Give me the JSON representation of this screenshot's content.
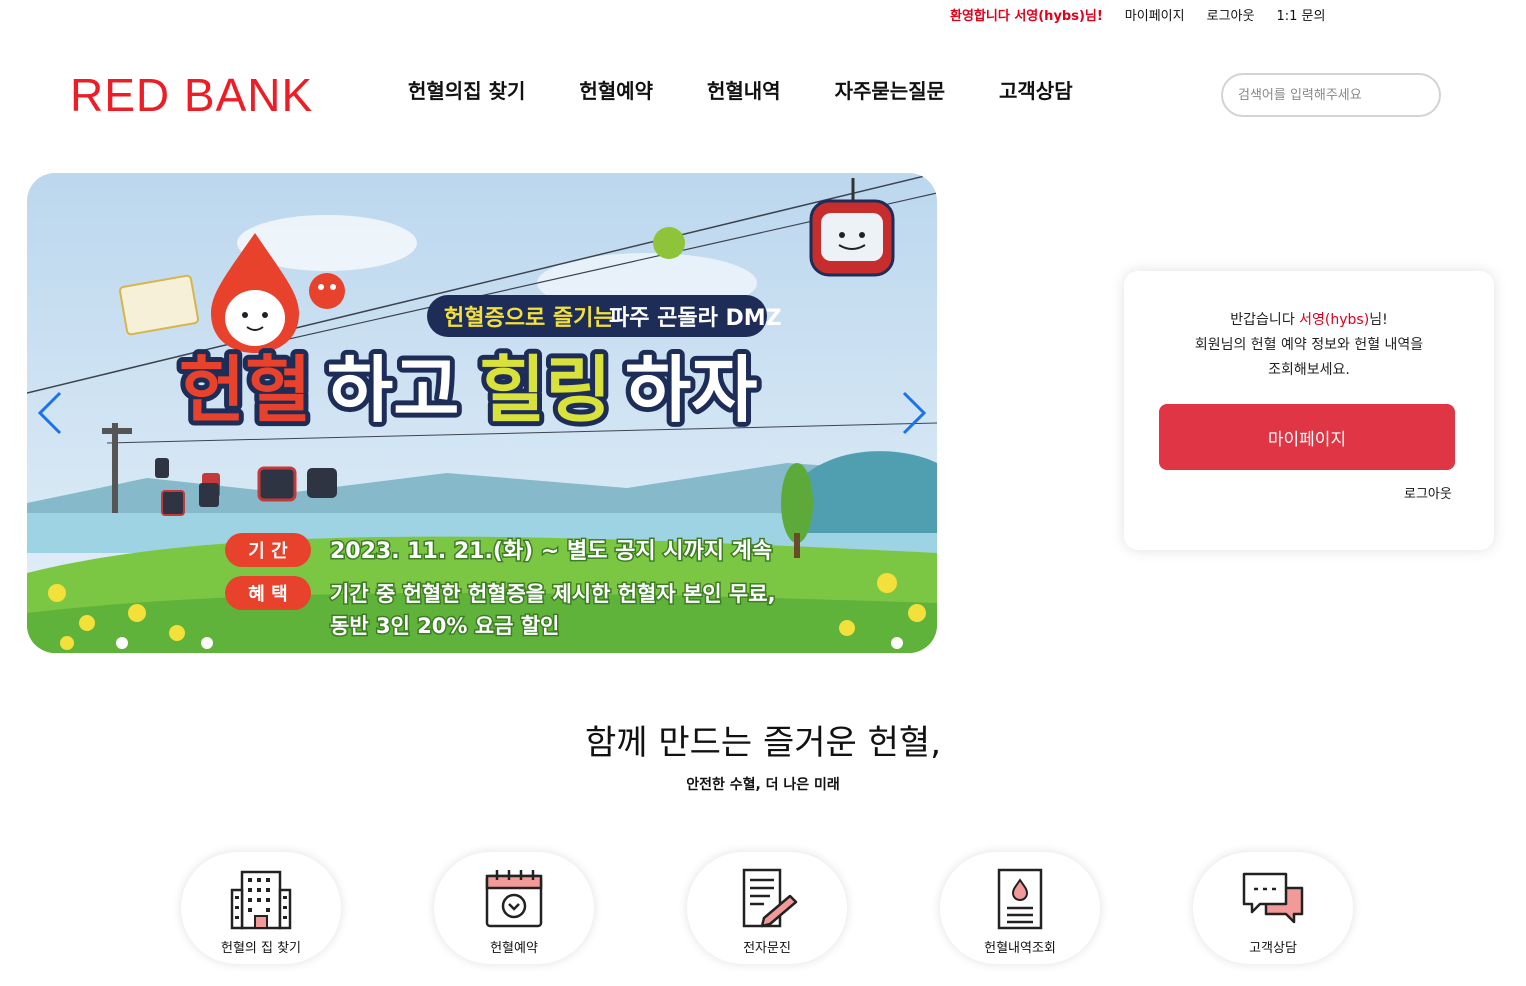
{
  "topbar": {
    "welcome": "환영합니다 서영(hybs)님!",
    "mypage": "마이페이지",
    "logout": "로그아웃",
    "inquiry": "1:1 문의"
  },
  "header": {
    "logo": "RED BANK",
    "nav": [
      "헌혈의집 찾기",
      "헌혈예약",
      "헌혈내역",
      "자주묻는질문",
      "고객상담"
    ],
    "search_placeholder": "검색어를 입력해주세요"
  },
  "banner": {
    "subtitle": "헌혈증으로 즐기는 파주 곤돌라 DMZ",
    "title_a": "헌혈",
    "title_b": "하고 ",
    "title_c": "힐링",
    "title_d": "하자",
    "period_label": "기 간",
    "period_text": "2023. 11. 21.(화) ~ 별도 공지 시까지 계속",
    "benefit_label": "혜 택",
    "benefit_line1": "기간 중 헌혈한 헌혈증을 제시한 헌혈자 본인 무료,",
    "benefit_line2": "동반 3인 20% 요금 할인",
    "colors": {
      "red": "#e8412c",
      "yellow": "#d8e23a",
      "navy": "#1d2d57",
      "grass": "#7bc744"
    }
  },
  "card": {
    "greet_prefix": "반갑습니다 ",
    "name": "서영(hybs)",
    "greet_suffix": "님!",
    "line2": "회원님의 헌혈 예약 정보와 헌혈 내역을",
    "line3": "조회해보세요.",
    "button": "마이페이지",
    "logout": "로그아웃"
  },
  "tagline": {
    "title": "함께 만드는 즐거운 헌혈,",
    "subtitle": "안전한 수혈, 더 나은 미래"
  },
  "quick_menu": [
    {
      "label": "헌혈의 집 찾기",
      "icon": "building-icon"
    },
    {
      "label": "헌혈예약",
      "icon": "calendar-icon"
    },
    {
      "label": "전자문진",
      "icon": "document-pen-icon"
    },
    {
      "label": "헌혈내역조회",
      "icon": "blood-record-icon"
    },
    {
      "label": "고객상담",
      "icon": "chat-bubbles-icon"
    }
  ],
  "colors": {
    "brand_red": "#ee1c25",
    "button_red": "#e03545",
    "arrow_blue": "#1a73e8"
  }
}
